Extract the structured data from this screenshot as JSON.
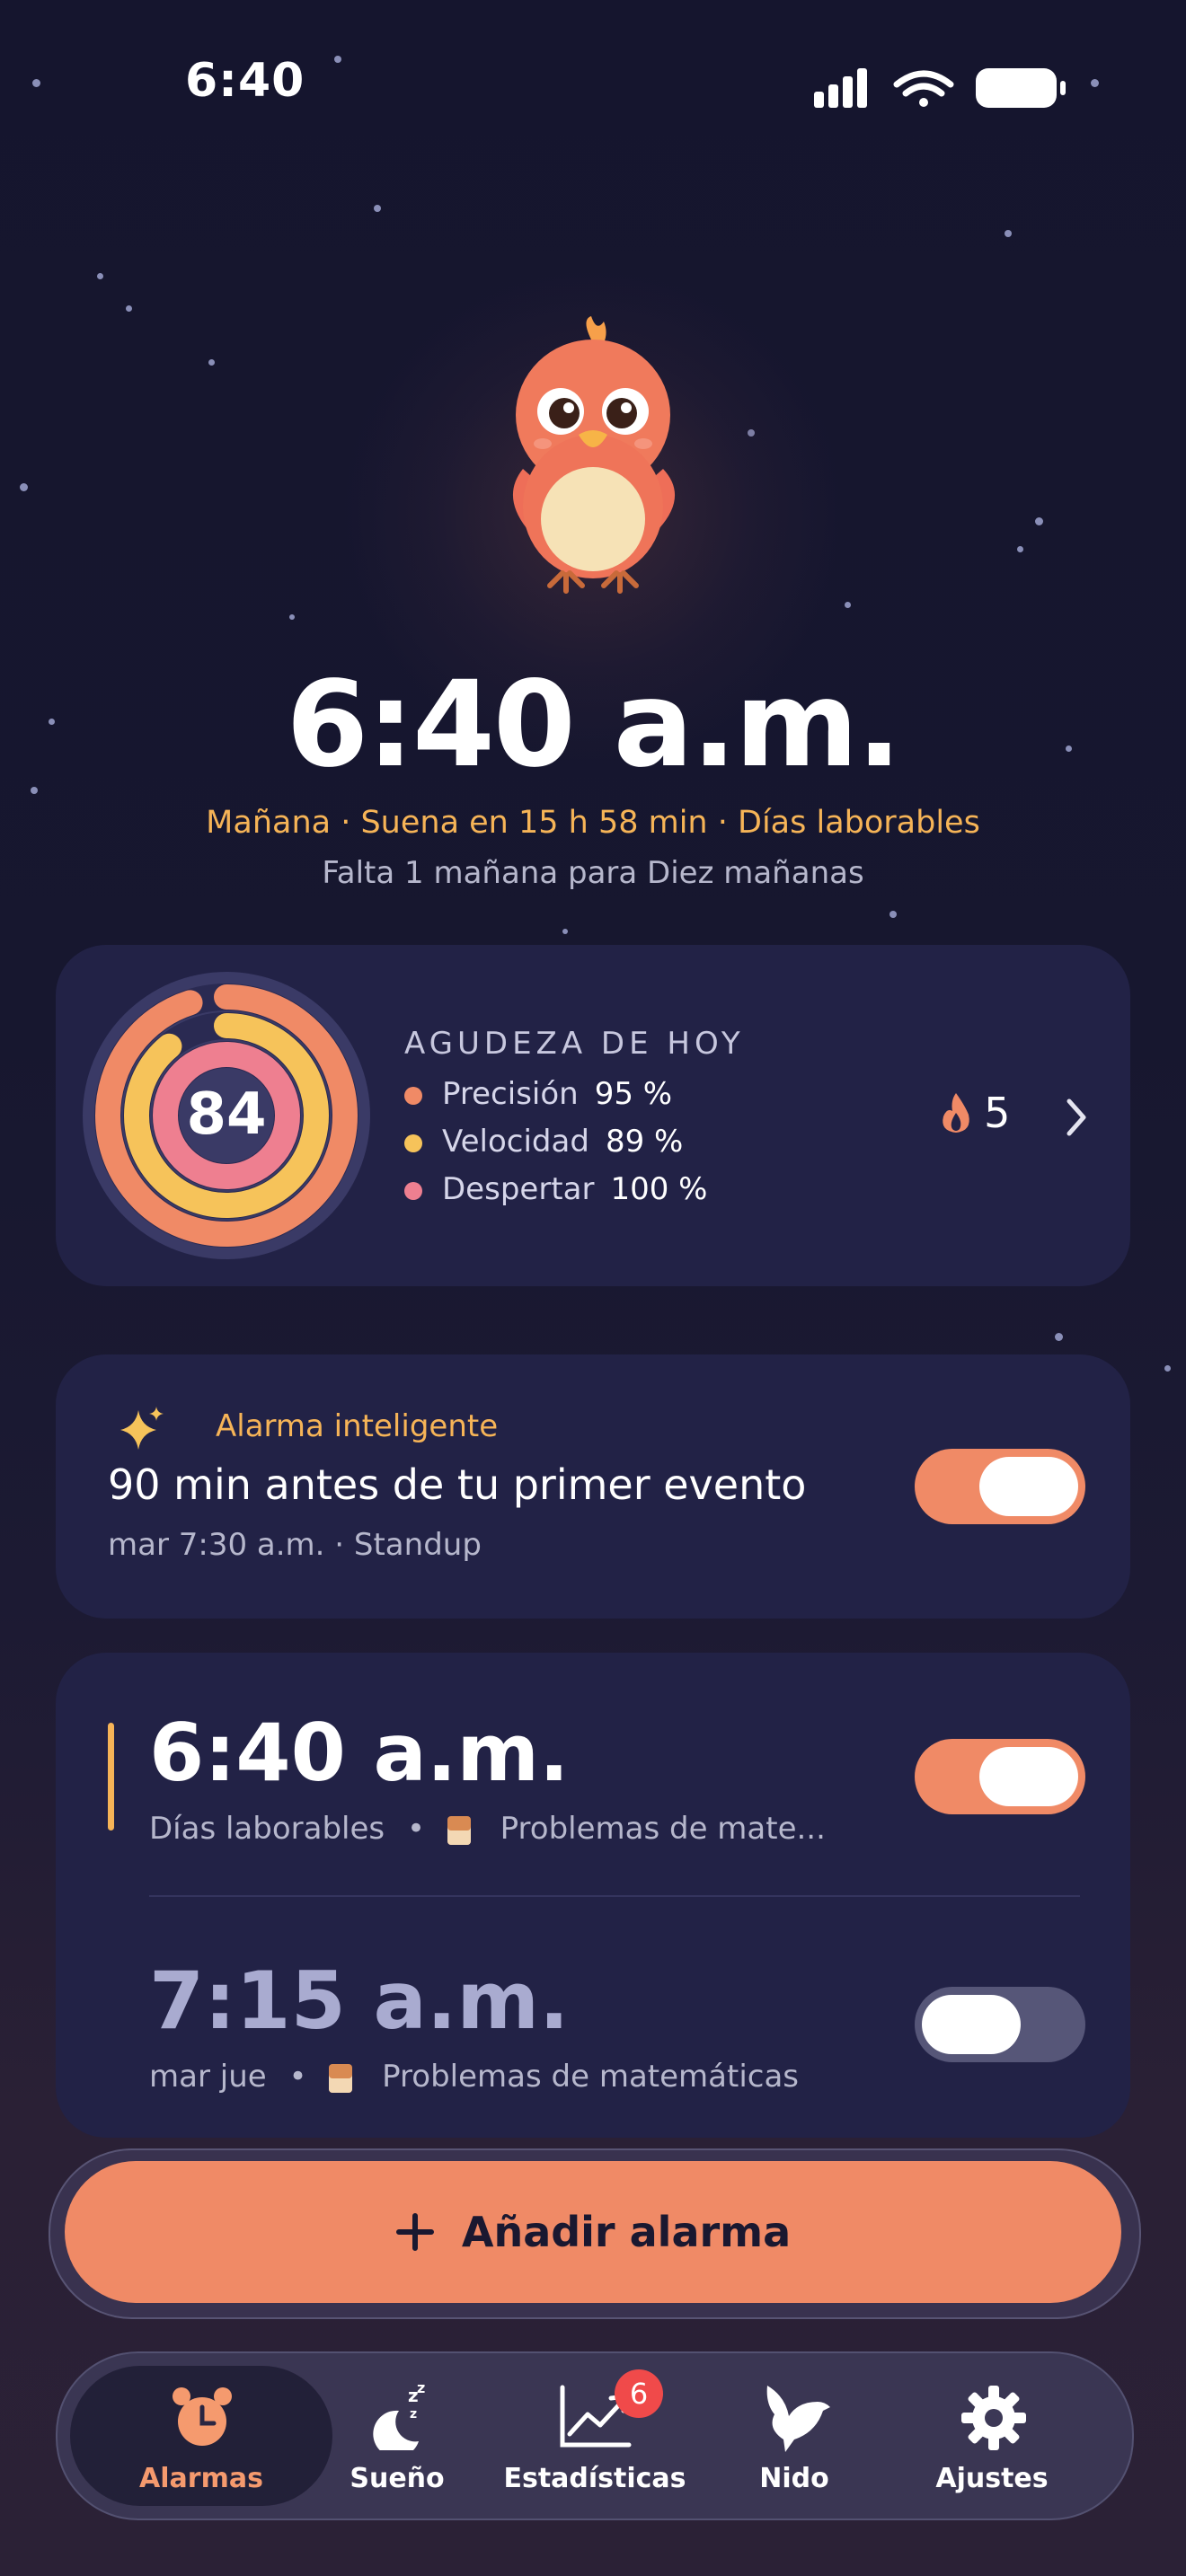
{
  "status_bar": {
    "time": "6:40"
  },
  "hero": {
    "alarm_time": "6:40 a.m.",
    "subtitle": "Mañana · Suena en 15 h 58 min · Días laborables",
    "streak_hint": "Falta 1 mañana para Diez mañanas"
  },
  "sharpness": {
    "title": "AGUDEZA DE HOY",
    "score": "84",
    "metrics": [
      {
        "label": "Precisión",
        "value": "95 %",
        "fraction": 0.95,
        "color": "#f08a66"
      },
      {
        "label": "Velocidad",
        "value": "89 %",
        "fraction": 0.89,
        "color": "#f6c35a"
      },
      {
        "label": "Despertar",
        "value": "100 %",
        "fraction": 1.0,
        "color": "#ee7f90"
      }
    ],
    "streak_count": "5"
  },
  "smart_alarm": {
    "title": "Alarma inteligente",
    "description": "90 min antes de tu primer evento",
    "detail": "mar 7:30 a.m. · Standup",
    "enabled": true
  },
  "alarms": [
    {
      "time": "6:40 a.m.",
      "days": "Días laborables",
      "challenge": "Problemas de mate...",
      "enabled": true
    },
    {
      "time": "7:15 a.m.",
      "days": "mar jue",
      "challenge": "Problemas de matemáticas",
      "enabled": false
    }
  ],
  "add_button": {
    "label": "Añadir alarma"
  },
  "tabs": [
    {
      "label": "Alarmas",
      "icon": "alarm-clock-icon",
      "active": true
    },
    {
      "label": "Sueño",
      "icon": "moon-zzz-icon",
      "active": false
    },
    {
      "label": "Estadísticas",
      "icon": "chart-trend-icon",
      "active": false,
      "badge": "6"
    },
    {
      "label": "Nido",
      "icon": "bird-icon",
      "active": false
    },
    {
      "label": "Ajustes",
      "icon": "gear-icon",
      "active": false
    }
  ],
  "colors": {
    "accent_orange": "#f08a66",
    "accent_yellow": "#f6b457",
    "card_bg": "#222246",
    "background": "#15152e"
  }
}
